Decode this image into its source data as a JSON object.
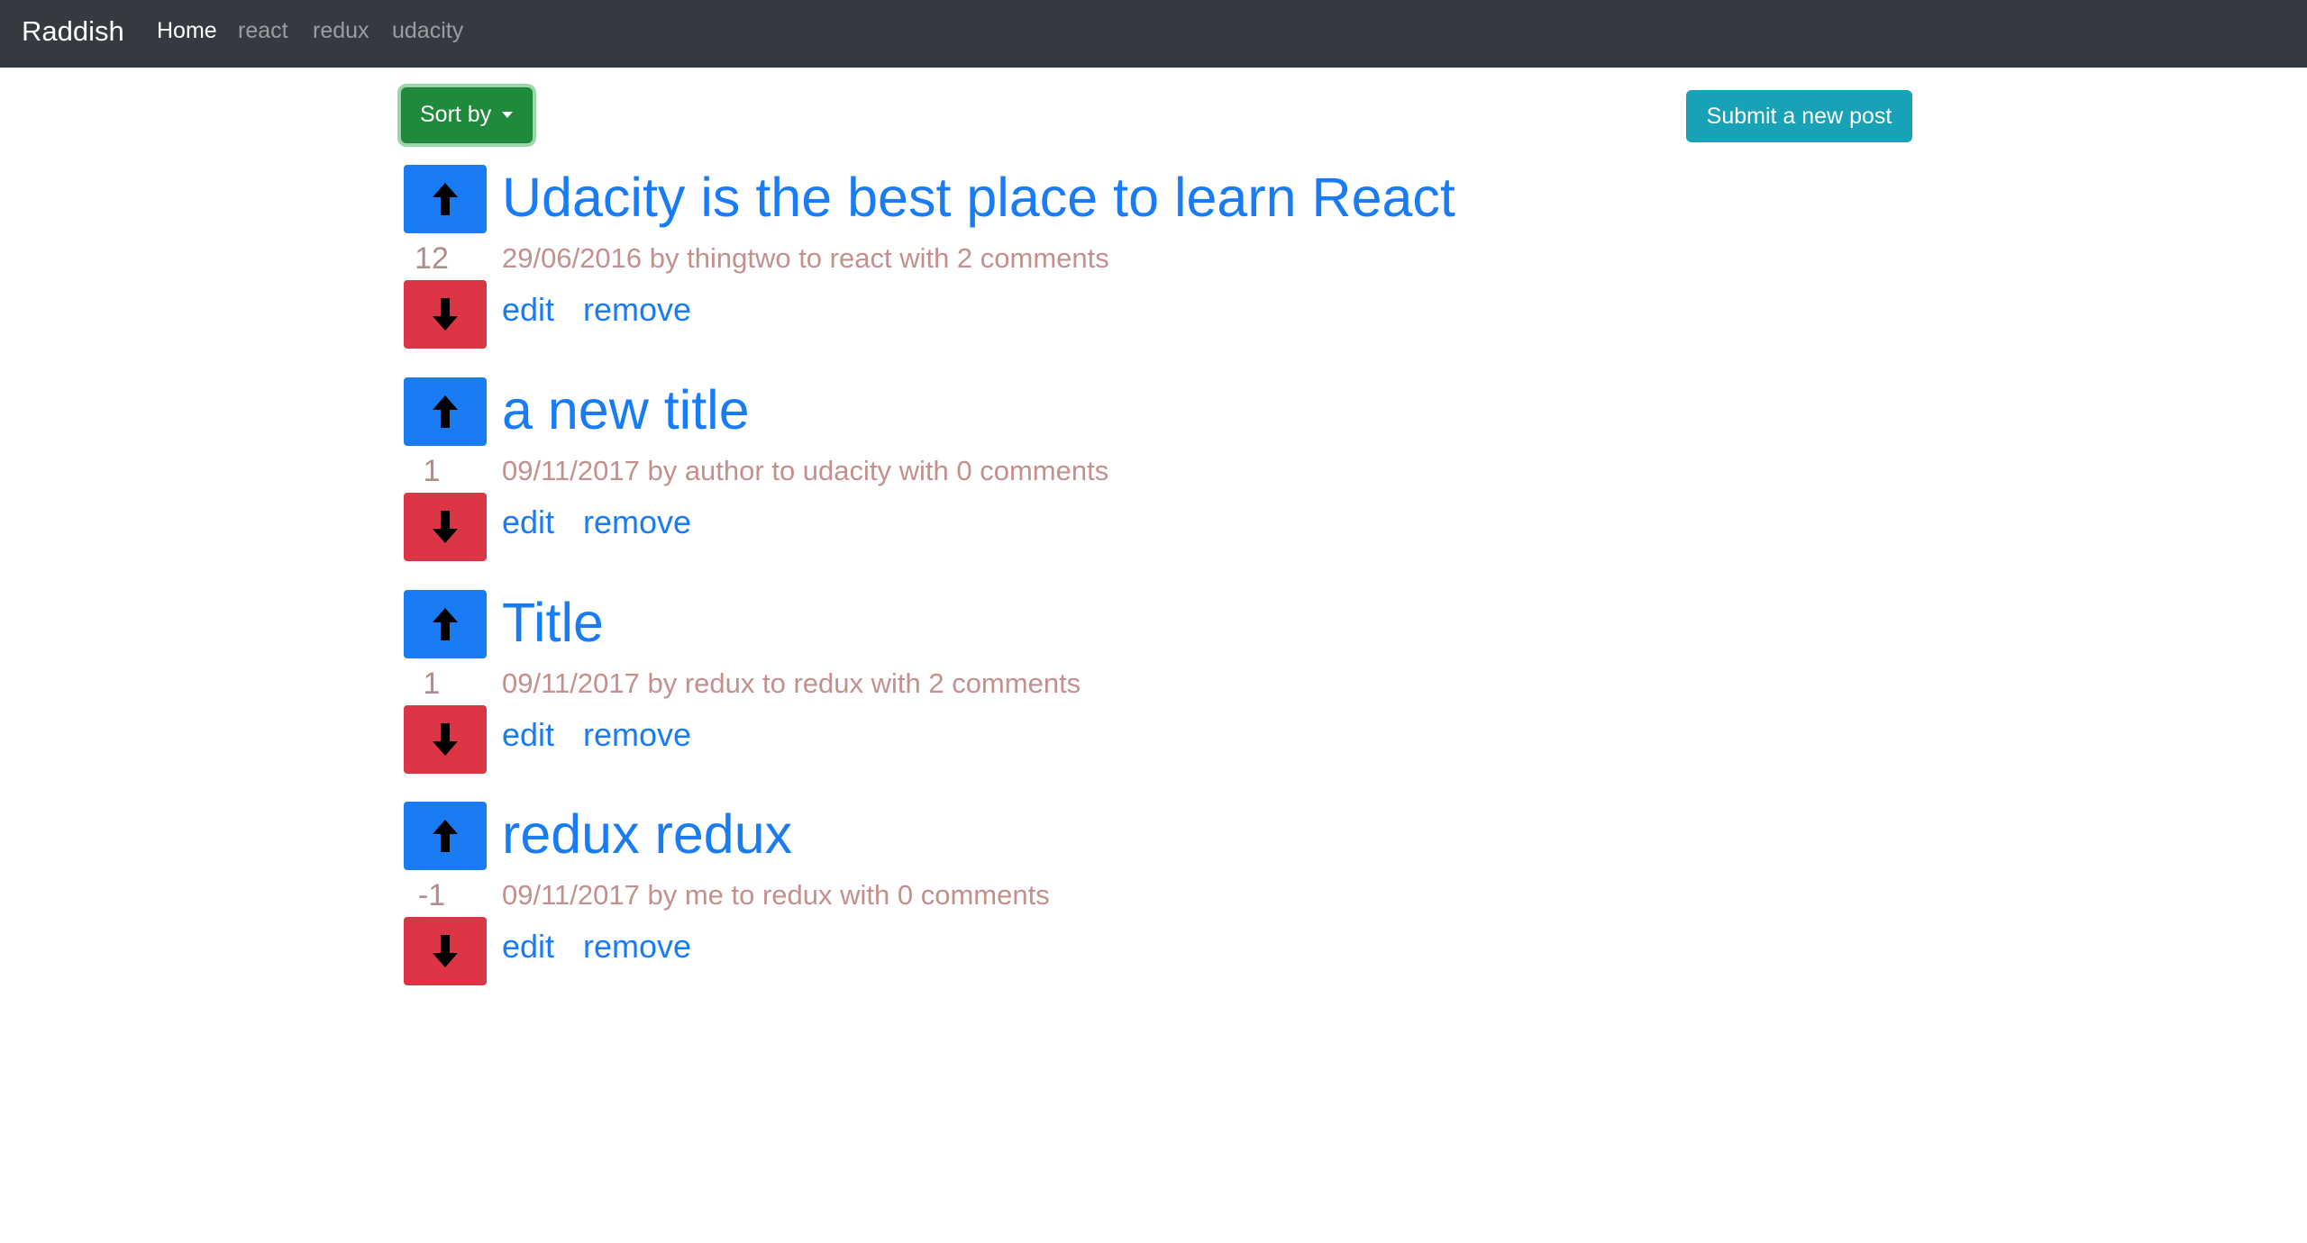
{
  "navbar": {
    "brand": "Raddish",
    "links": [
      {
        "label": "Home",
        "active": true
      },
      {
        "label": "react",
        "active": false
      },
      {
        "label": "redux",
        "active": false
      },
      {
        "label": "udacity",
        "active": false
      }
    ]
  },
  "toolbar": {
    "sort_label": "Sort by",
    "submit_label": "Submit a new post"
  },
  "posts": [
    {
      "title": "Udacity is the best place to learn React",
      "score": "12",
      "meta": "29/06/2016 by thingtwo to react with 2 comments",
      "edit_label": "edit",
      "remove_label": "remove"
    },
    {
      "title": "a new title",
      "score": "1",
      "meta": "09/11/2017 by author to udacity with 0 comments",
      "edit_label": "edit",
      "remove_label": "remove"
    },
    {
      "title": "Title",
      "score": "1",
      "meta": "09/11/2017 by redux to redux with 2 comments",
      "edit_label": "edit",
      "remove_label": "remove"
    },
    {
      "title": "redux redux",
      "score": "-1",
      "meta": "09/11/2017 by me to redux with 0 comments",
      "edit_label": "edit",
      "remove_label": "remove"
    }
  ],
  "icons": {
    "upvote": "arrow-up-icon",
    "downvote": "arrow-down-icon",
    "sort_caret": "caret-down-icon"
  },
  "colors": {
    "navbar": "#343a40",
    "sort_button": "#208a3c",
    "submit_button": "#17a2b8",
    "upvote": "#1a7cf4",
    "downvote": "#dc3545",
    "link": "#1a7cf4",
    "meta_text": "#c4908e"
  }
}
